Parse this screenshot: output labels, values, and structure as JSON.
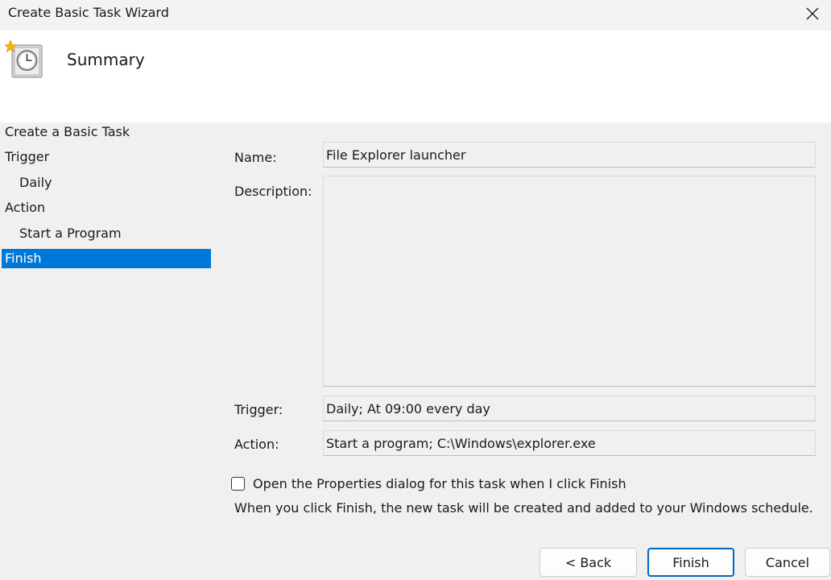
{
  "window": {
    "title": "Create Basic Task Wizard"
  },
  "header": {
    "title": "Summary",
    "icon": "clock-star-icon"
  },
  "nav": {
    "items": [
      {
        "label": "Create a Basic Task",
        "level": 0,
        "selected": false
      },
      {
        "label": "Trigger",
        "level": 0,
        "selected": false
      },
      {
        "label": "Daily",
        "level": 1,
        "selected": false
      },
      {
        "label": "Action",
        "level": 0,
        "selected": false
      },
      {
        "label": "Start a Program",
        "level": 1,
        "selected": false
      },
      {
        "label": "Finish",
        "level": 0,
        "selected": true
      }
    ]
  },
  "summary": {
    "name_label": "Name:",
    "name_value": "File Explorer launcher",
    "description_label": "Description:",
    "description_value": "",
    "trigger_label": "Trigger:",
    "trigger_value": "Daily; At 09:00 every day",
    "action_label": "Action:",
    "action_value": "Start a program; C:\\Windows\\explorer.exe"
  },
  "options": {
    "open_properties_label": "Open the Properties dialog for this task when I click Finish",
    "open_properties_checked": false,
    "info_text": "When you click Finish, the new task will be created and added to your Windows schedule."
  },
  "buttons": {
    "back": "< Back",
    "finish": "Finish",
    "cancel": "Cancel"
  },
  "colors": {
    "selection": "#0078d7",
    "default_button_border": "#0067c0"
  }
}
